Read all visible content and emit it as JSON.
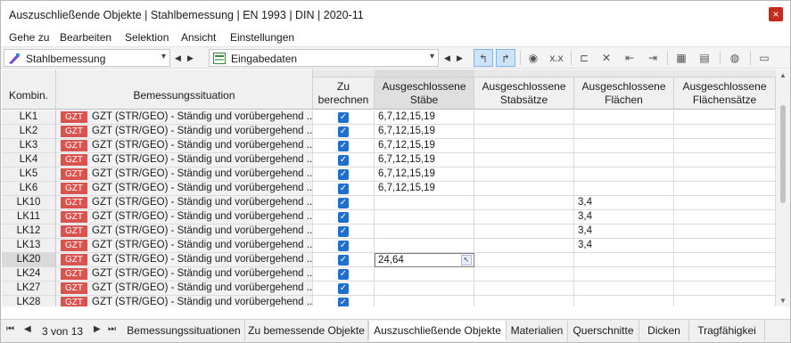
{
  "window": {
    "title": "Auszuschließende Objekte | Stahlbemessung | EN 1993 | DIN | 2020-11",
    "close_icon": "×"
  },
  "menu": [
    "Gehe zu",
    "Bearbeiten",
    "Selektion",
    "Ansicht",
    "Einstellungen"
  ],
  "toolbar": {
    "module": "Stahlbemessung",
    "category": "Eingabedaten"
  },
  "table": {
    "headers": {
      "kombi": "Kombin.",
      "situation": "Bemessungssituation",
      "calc": "Zu\nberechnen",
      "staebe": "Ausgeschlossene\nStäbe",
      "stabsaetze": "Ausgeschlossene\nStabsätze",
      "flaechen": "Ausgeschlossene\nFlächen",
      "flaechensaetze": "Ausgeschlossene\nFlächensätze"
    },
    "rows": [
      {
        "kombi": "LK1",
        "gzt": "GZT",
        "situation": "GZT (STR/GEO) - Ständig und vorübergehend ...",
        "staebe": "6,7,12,15,19",
        "flaechen": ""
      },
      {
        "kombi": "LK2",
        "gzt": "GZT",
        "situation": "GZT (STR/GEO) - Ständig und vorübergehend ...",
        "staebe": "6,7,12,15,19",
        "flaechen": ""
      },
      {
        "kombi": "LK3",
        "gzt": "GZT",
        "situation": "GZT (STR/GEO) - Ständig und vorübergehend ...",
        "staebe": "6,7,12,15,19",
        "flaechen": ""
      },
      {
        "kombi": "LK4",
        "gzt": "GZT",
        "situation": "GZT (STR/GEO) - Ständig und vorübergehend ...",
        "staebe": "6,7,12,15,19",
        "flaechen": ""
      },
      {
        "kombi": "LK5",
        "gzt": "GZT",
        "situation": "GZT (STR/GEO) - Ständig und vorübergehend ...",
        "staebe": "6,7,12,15,19",
        "flaechen": ""
      },
      {
        "kombi": "LK6",
        "gzt": "GZT",
        "situation": "GZT (STR/GEO) - Ständig und vorübergehend ...",
        "staebe": "6,7,12,15,19",
        "flaechen": ""
      },
      {
        "kombi": "LK10",
        "gzt": "GZT",
        "situation": "GZT (STR/GEO) - Ständig und vorübergehend ...",
        "staebe": "",
        "flaechen": "3,4"
      },
      {
        "kombi": "LK11",
        "gzt": "GZT",
        "situation": "GZT (STR/GEO) - Ständig und vorübergehend ...",
        "staebe": "",
        "flaechen": "3,4"
      },
      {
        "kombi": "LK12",
        "gzt": "GZT",
        "situation": "GZT (STR/GEO) - Ständig und vorübergehend ...",
        "staebe": "",
        "flaechen": "3,4"
      },
      {
        "kombi": "LK13",
        "gzt": "GZT",
        "situation": "GZT (STR/GEO) - Ständig und vorübergehend ...",
        "staebe": "",
        "flaechen": "3,4"
      },
      {
        "kombi": "LK20",
        "gzt": "GZT",
        "situation": "GZT (STR/GEO) - Ständig und vorübergehend ...",
        "staebe": "24,64",
        "flaechen": "",
        "editing": true
      },
      {
        "kombi": "LK24",
        "gzt": "GZT",
        "situation": "GZT (STR/GEO) - Ständig und vorübergehend ...",
        "staebe": "",
        "flaechen": ""
      },
      {
        "kombi": "LK27",
        "gzt": "GZT",
        "situation": "GZT (STR/GEO) - Ständig und vorübergehend ...",
        "staebe": "",
        "flaechen": ""
      },
      {
        "kombi": "LK28",
        "gzt": "GZT",
        "situation": "GZT (STR/GEO) - Ständig und vorübergehend ...",
        "staebe": "",
        "flaechen": ""
      }
    ]
  },
  "pager": "3 von 13",
  "tabs": [
    "Bemessungssituationen",
    "Zu bemessende Objekte",
    "Auszuschließende Objekte",
    "Materialien",
    "Querschnitte",
    "Dicken",
    "Tragfähigkei"
  ],
  "active_tab": "Auszuschließende Objekte",
  "colors": {
    "gzt_badge": "#d9534f",
    "checkbox": "#1f6fd1",
    "close": "#c42b1c"
  }
}
